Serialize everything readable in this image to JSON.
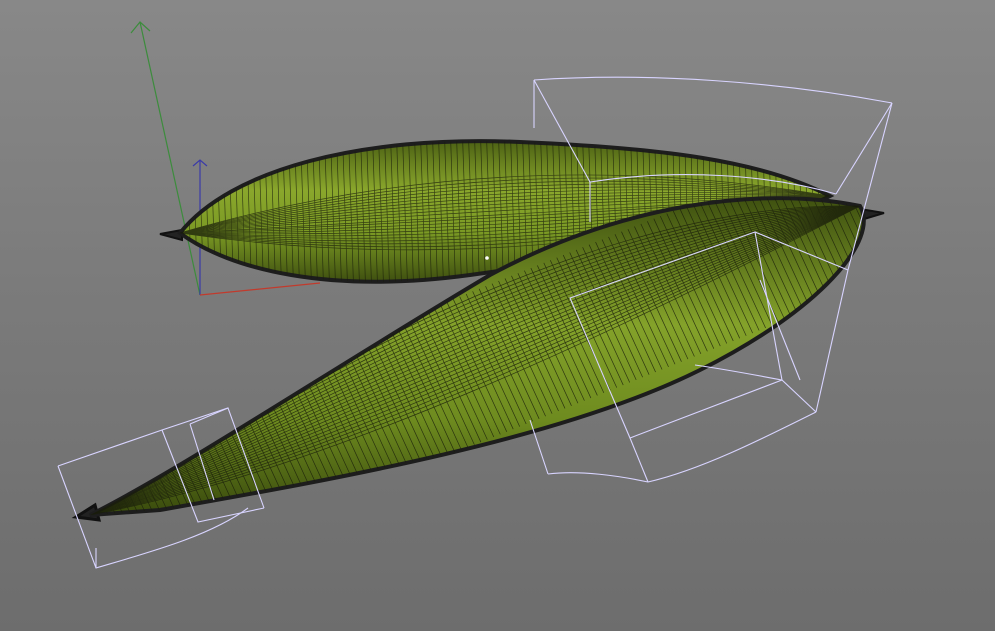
{
  "viewport": {
    "name": "3d-viewport",
    "background_top": "#888888",
    "background_bottom": "#6d6d6d"
  },
  "axes": {
    "x_color": "#c23a2c",
    "y_color": "#3c8c3c",
    "z_color": "#3a3aa8"
  },
  "objects": [
    {
      "id": "upper-leaf",
      "color": "#6f8a21",
      "wire_color": "#1b1f0c"
    },
    {
      "id": "lower-leaf",
      "color": "#6a8420",
      "wire_color": "#1b1f0c"
    }
  ],
  "lattice": {
    "color": "#d8d4ff"
  }
}
